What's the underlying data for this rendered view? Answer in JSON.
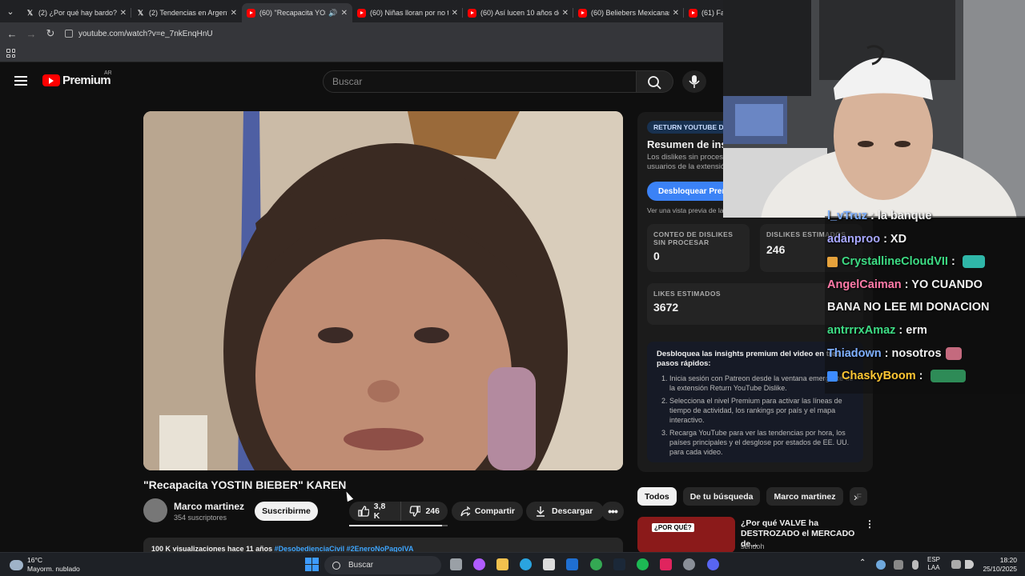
{
  "browser": {
    "tabs": [
      {
        "title": "(2) ¿Por qué hay bardo? e",
        "icon": "x-logo-icon",
        "active": false
      },
      {
        "title": "(2) Tendencias en Argentin",
        "icon": "x-logo-icon",
        "active": false
      },
      {
        "title": "(60) \"Recapacita YOST",
        "icon": "youtube-icon",
        "active": true,
        "audio": true
      },
      {
        "title": "(60) Niñas lloran por no t",
        "icon": "youtube-icon",
        "active": false
      },
      {
        "title": "(60) Así lucen 10 años des",
        "icon": "youtube-icon",
        "active": false
      },
      {
        "title": "(60) Beliebers Mexicanas",
        "icon": "youtube-icon",
        "active": false
      },
      {
        "title": "(61) Fa",
        "icon": "youtube-icon",
        "active": false
      }
    ],
    "url": "youtube.com/watch?v=e_7nkEnqHnU"
  },
  "youtube": {
    "logo_text": "Premium",
    "country_code": "AR",
    "search_placeholder": "Buscar"
  },
  "video": {
    "title": "\"Recapacita YOSTIN BIEBER\" KAREN",
    "channel_name": "Marco martinez",
    "subscribers": "354 suscriptores",
    "subscribe_label": "Suscribirme",
    "likes": "3,8 K",
    "dislikes": "246",
    "share_label": "Compartir",
    "download_label": "Descargar",
    "like_ratio": 0.94,
    "description_views": "100 K visualizaciones  hace 11 años",
    "description_tags": "#DesobedienciaCivil #2EneroNoPagoIVA"
  },
  "ryd_panel": {
    "badge": "RETURN YOUTUBE DI",
    "heading": "Resumen de ins",
    "subtitle_line1": "Los dislikes sin proces",
    "subtitle_line2": "usuarios de la extensió",
    "unlock_button": "Desbloquear Premi",
    "link_text": "Ver una vista previa de la",
    "stats": {
      "raw_dislikes_label": "CONTEO DE DISLIKES SIN PROCESAR",
      "raw_dislikes_value": "0",
      "est_dislikes_label": "DISLIKES ESTIMADOS",
      "est_dislikes_value": "246",
      "est_likes_label": "LIKES ESTIMADOS",
      "est_likes_value": "3672"
    },
    "insight_heading": "Desbloquea las insights premium del video en tres pasos rápidos:",
    "steps": [
      "Inicia sesión con Patreon desde la ventana emergente de la extensión Return YouTube Dislike.",
      "Selecciona el nivel Premium para activar las líneas de tiempo de actividad, los rankings por país y el mapa interactivo.",
      "Recarga YouTube para ver las tendencias por hora, los países principales y el desglose por estados de EE. UU. para cada video."
    ]
  },
  "filter_chips": [
    "Todos",
    "De tu búsqueda",
    "Marco martinez",
    "F"
  ],
  "recommendation": {
    "thumb_label": "¿POR QUÉ?",
    "title": "¿Por qué VALVE ha DESTROZADO el MERCADO de...",
    "channel": "sendoh"
  },
  "chat": [
    {
      "user": "l_vTruz",
      "message": "la banque",
      "color": "#7fb0ff",
      "badge": null,
      "emote": null
    },
    {
      "user": "adanproo",
      "message": "XD",
      "color": "#a7a7ff",
      "badge": null,
      "emote": null
    },
    {
      "user": "CrystallineCloudVII",
      "message": "",
      "color": "#3ddc84",
      "badge": "#e6a23c",
      "emote": "#2fb6a8"
    },
    {
      "user": "AngelCaiman",
      "message": "YO CUANDO",
      "color": "#ff7aa8",
      "badge": null,
      "emote": null
    },
    {
      "user": "",
      "message": "BANA NO LEE MI DONACION",
      "color": "#ffffff",
      "badge": null,
      "emote": null
    },
    {
      "user": "antrrrxAmaz",
      "message": "erm",
      "color": "#3ddc84",
      "badge": null,
      "emote": null
    },
    {
      "user": "Thiadown",
      "message": "nosotros",
      "color": "#7fb0ff",
      "badge": null,
      "emote": "#c46a7e"
    },
    {
      "user": "ChaskyBoom",
      "message": "",
      "color": "#ffc733",
      "badge": "#3d8bff",
      "emote": "#2e8b57"
    }
  ],
  "taskbar": {
    "temperature": "16°C",
    "weather": "Mayorm. nublado",
    "search_label": "Buscar",
    "lang_line1": "ESP",
    "lang_line2": "LAA",
    "time": "18:20",
    "date": "25/10/2025"
  },
  "colors": {
    "youtube_red": "#ff0000",
    "accent_blue": "#3ea6ff",
    "page_bg": "#0f0f0f"
  }
}
